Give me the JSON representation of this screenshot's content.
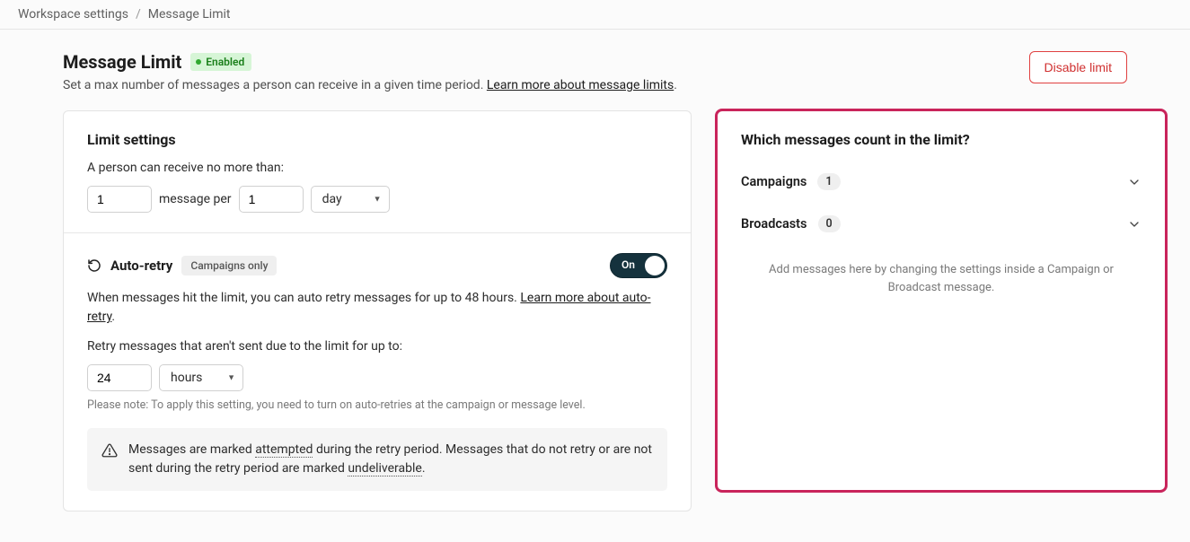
{
  "breadcrumb": {
    "parent": "Workspace settings",
    "sep": "/",
    "current": "Message Limit"
  },
  "header": {
    "title": "Message Limit",
    "status_label": "Enabled",
    "subtitle_lead": "Set a max number of messages a person can receive in a given time period. ",
    "subtitle_link": "Learn more about message limits",
    "subtitle_tail": ".",
    "disable_label": "Disable limit"
  },
  "limit": {
    "section_title": "Limit settings",
    "field_label": "A person can receive no more than:",
    "count_value": "1",
    "mid_text": "message per",
    "per_value": "1",
    "unit_value": "day"
  },
  "autoretry": {
    "title": "Auto-retry",
    "tag": "Campaigns only",
    "toggle_label": "On",
    "desc_lead": "When messages hit the limit, you can auto retry messages for up to 48 hours. ",
    "desc_link": "Learn more about auto-retry",
    "desc_tail": ".",
    "retry_label": "Retry messages that aren't sent due to the limit for up to:",
    "retry_value": "24",
    "retry_unit": "hours",
    "note": "Please note: To apply this setting, you need to turn on auto-retries at the campaign or message level.",
    "notice_lead": "Messages are marked ",
    "notice_word1": "attempted",
    "notice_mid": " during the retry period. Messages that do not retry or are not sent during the retry period are marked ",
    "notice_word2": "undeliverable",
    "notice_tail": "."
  },
  "rightcard": {
    "title": "Which messages count in the limit?",
    "rows": [
      {
        "label": "Campaigns",
        "count": "1"
      },
      {
        "label": "Broadcasts",
        "count": "0"
      }
    ],
    "help": "Add messages here by changing the settings inside a Campaign or Broadcast message."
  }
}
